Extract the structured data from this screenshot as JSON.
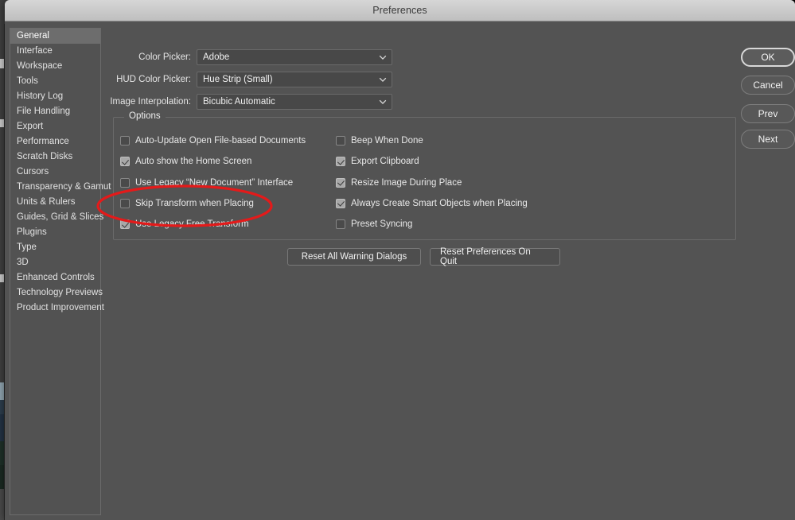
{
  "window": {
    "title": "Preferences"
  },
  "sidebar": {
    "items": [
      {
        "label": "General",
        "selected": true
      },
      {
        "label": "Interface",
        "selected": false
      },
      {
        "label": "Workspace",
        "selected": false
      },
      {
        "label": "Tools",
        "selected": false
      },
      {
        "label": "History Log",
        "selected": false
      },
      {
        "label": "File Handling",
        "selected": false
      },
      {
        "label": "Export",
        "selected": false
      },
      {
        "label": "Performance",
        "selected": false
      },
      {
        "label": "Scratch Disks",
        "selected": false
      },
      {
        "label": "Cursors",
        "selected": false
      },
      {
        "label": "Transparency & Gamut",
        "selected": false
      },
      {
        "label": "Units & Rulers",
        "selected": false
      },
      {
        "label": "Guides, Grid & Slices",
        "selected": false
      },
      {
        "label": "Plugins",
        "selected": false
      },
      {
        "label": "Type",
        "selected": false
      },
      {
        "label": "3D",
        "selected": false
      },
      {
        "label": "Enhanced Controls",
        "selected": false
      },
      {
        "label": "Technology Previews",
        "selected": false
      },
      {
        "label": "Product Improvement",
        "selected": false
      }
    ]
  },
  "fields": [
    {
      "label": "Color Picker:",
      "value": "Adobe"
    },
    {
      "label": "HUD Color Picker:",
      "value": "Hue Strip (Small)"
    },
    {
      "label": "Image Interpolation:",
      "value": "Bicubic Automatic"
    }
  ],
  "options_group": {
    "legend": "Options",
    "left_column": [
      {
        "label": "Auto-Update Open File-based Documents",
        "checked": false
      },
      {
        "label": "Auto show the Home Screen",
        "checked": true
      },
      {
        "label": "Use Legacy “New Document” Interface",
        "checked": false
      },
      {
        "label": "Skip Transform when Placing",
        "checked": false
      },
      {
        "label": "Use Legacy Free Transform",
        "checked": true
      }
    ],
    "right_column": [
      {
        "label": "Beep When Done",
        "checked": false
      },
      {
        "label": "Export Clipboard",
        "checked": true
      },
      {
        "label": "Resize Image During Place",
        "checked": true
      },
      {
        "label": "Always Create Smart Objects when Placing",
        "checked": true
      },
      {
        "label": "Preset Syncing",
        "checked": false
      }
    ]
  },
  "bottom_buttons": {
    "reset_warning_dialogs": "Reset All Warning Dialogs",
    "reset_preferences_on_quit": "Reset Preferences On Quit"
  },
  "action_buttons": {
    "ok": "OK",
    "cancel": "Cancel",
    "prev": "Prev",
    "next": "Next"
  },
  "annotation": {
    "shape": "ellipse",
    "color": "#e41a1a",
    "targets": "Use Legacy Free Transform"
  },
  "colors": {
    "dialog_background": "#535353",
    "titlebar": "#c9c9c9",
    "control_background": "#484848",
    "selected_item": "#6d6d6d",
    "text": "#e8e8e8",
    "annotation_red": "#e41a1a"
  }
}
